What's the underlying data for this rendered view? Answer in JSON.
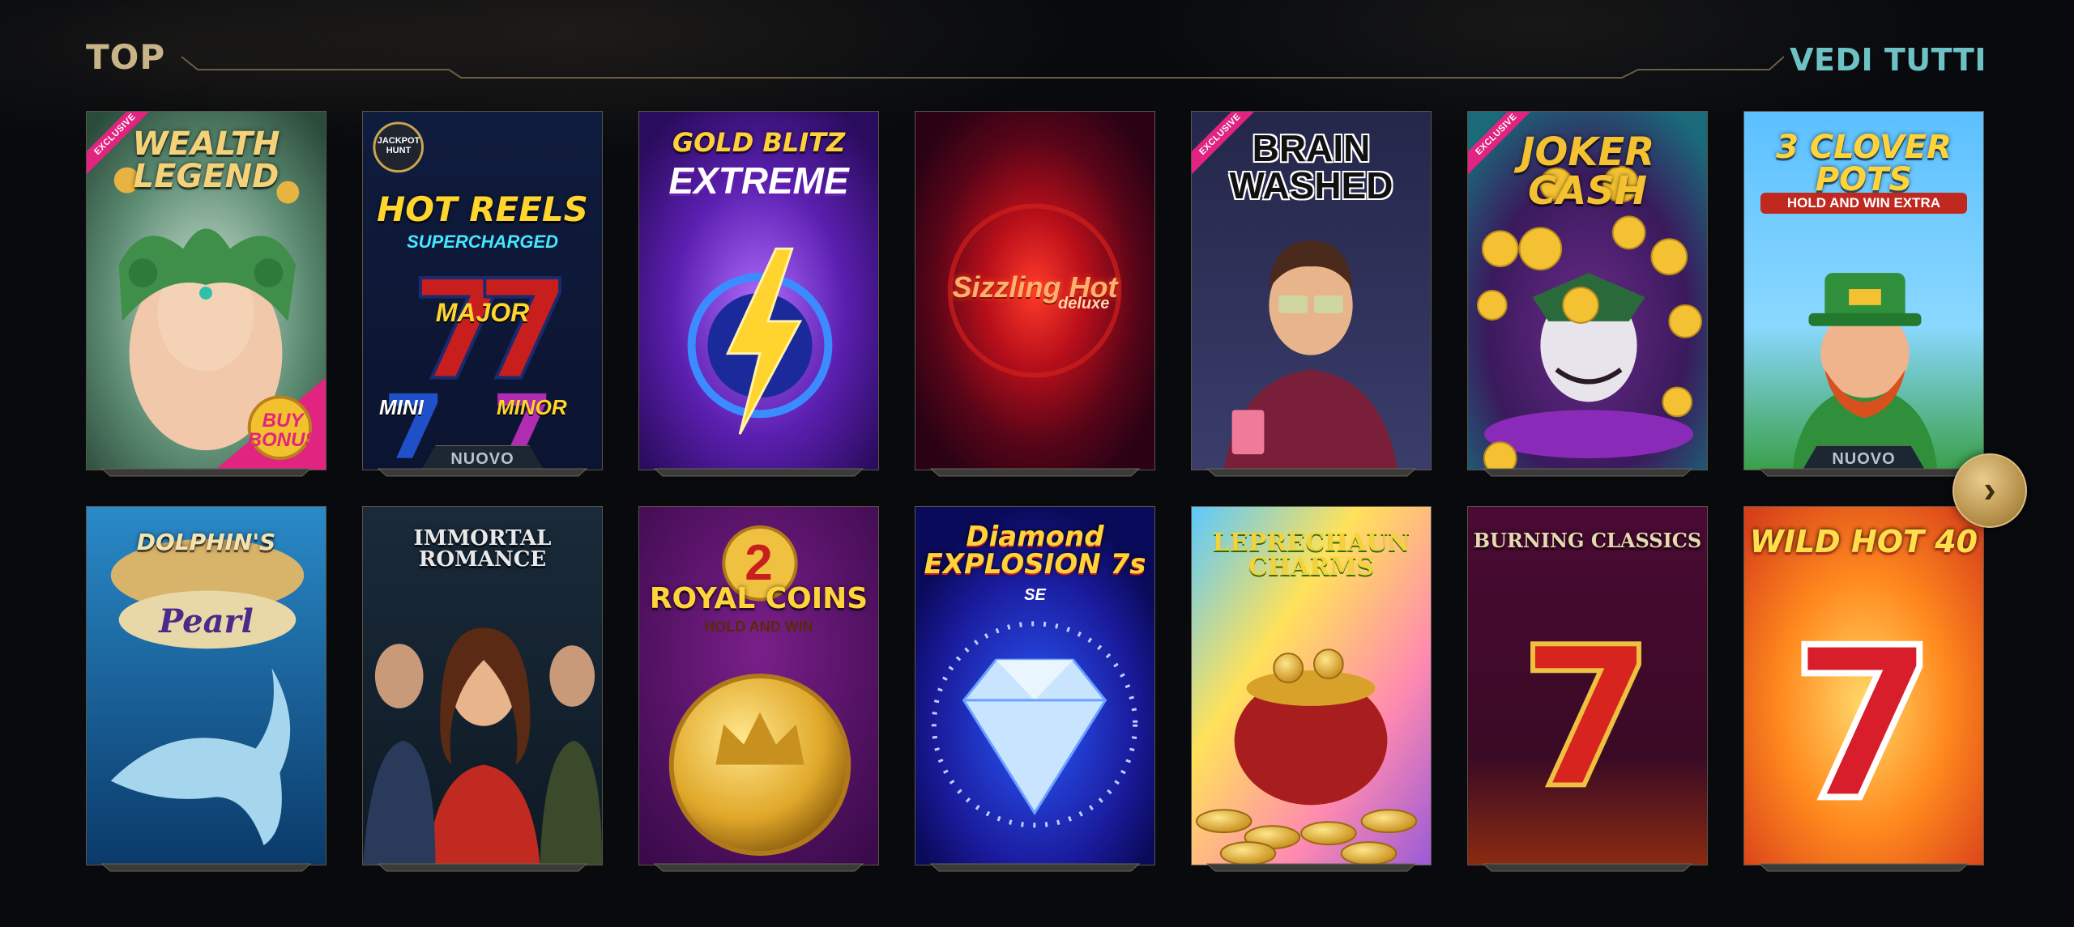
{
  "section": {
    "title": "TOP",
    "view_all": "VEDI TUTTI"
  },
  "badges": {
    "exclusive": "EXCLUSIVE",
    "new": "NUOVO",
    "next_icon": "chevron-right-icon"
  },
  "row1": [
    {
      "title": "WEALTH LEGEND",
      "extra": "BUY BONUS",
      "badge": "EXCLUSIVE"
    },
    {
      "title": "HOT REELS",
      "subtitle": "SUPERCHARGED",
      "logo": "JACKPOT HUNT",
      "extra": "MAJOR",
      "extra2": "MINI",
      "extra3": "MINOR",
      "badge": "NUOVO"
    },
    {
      "title": "GOLD BLITZ",
      "subtitle": "EXTREME"
    },
    {
      "title": "Sizzling Hot",
      "subtitle": "deluxe"
    },
    {
      "title": "BRAIN WASHED",
      "badge": "EXCLUSIVE"
    },
    {
      "title": "JOKER CASH",
      "badge": "EXCLUSIVE"
    },
    {
      "title": "3 CLOVER POTS",
      "subtitle": "HOLD AND WIN EXTRA",
      "badge": "NUOVO"
    }
  ],
  "row2": [
    {
      "title": "DOLPHIN'S",
      "subtitle": "Pearl"
    },
    {
      "title": "IMMORTAL ROMANCE"
    },
    {
      "title": "ROYAL COINS",
      "subtitle": "HOLD AND WIN",
      "extra": "2"
    },
    {
      "title": "Diamond EXPLOSION 7s",
      "subtitle": "SE"
    },
    {
      "title": "LEPRECHAUN CHARMS"
    },
    {
      "title": "BURNING CLASSICS"
    },
    {
      "title": "WILD HOT 40"
    }
  ],
  "colors": {
    "title_gold": "#c9b48a",
    "view_all_teal": "#6ec2c4",
    "exclusive_pink": "#e0247f"
  }
}
